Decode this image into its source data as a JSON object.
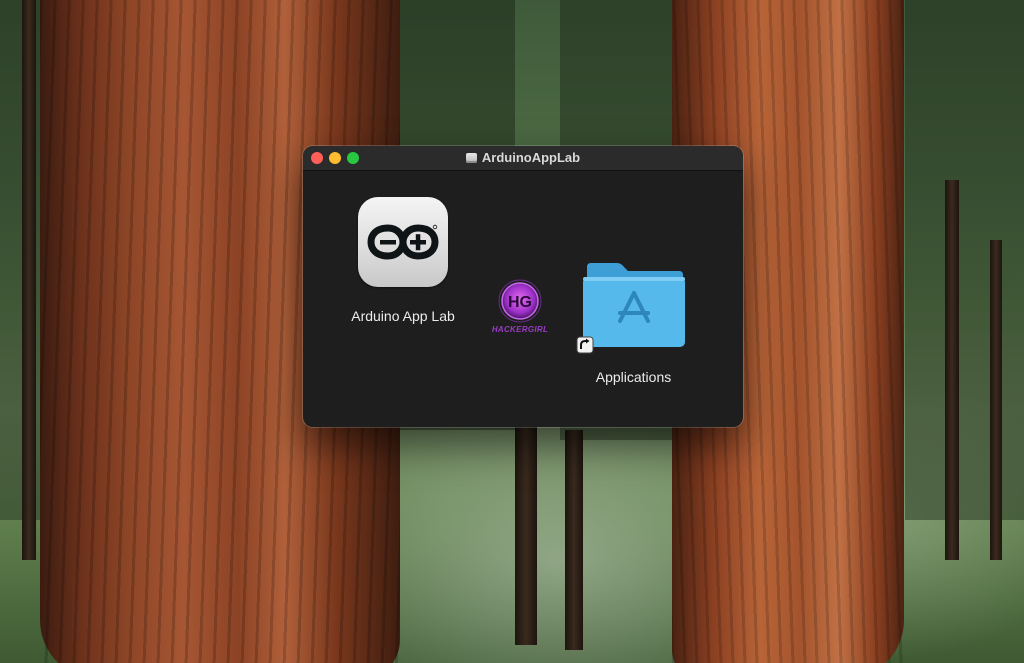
{
  "window": {
    "title": "ArduinoAppLab"
  },
  "items": {
    "app": {
      "label": "Arduino App Lab",
      "icon": "arduino-infinity-icon"
    },
    "applications": {
      "label": "Applications",
      "icon": "applications-folder-icon"
    }
  },
  "watermark": {
    "text": "HACKERGIRL",
    "monogram": "HG"
  },
  "colors": {
    "close": "#ff5f57",
    "minimize": "#febc2e",
    "maximize": "#28c840",
    "folder": "#4fb6ea",
    "arduino": "#0f1416"
  }
}
